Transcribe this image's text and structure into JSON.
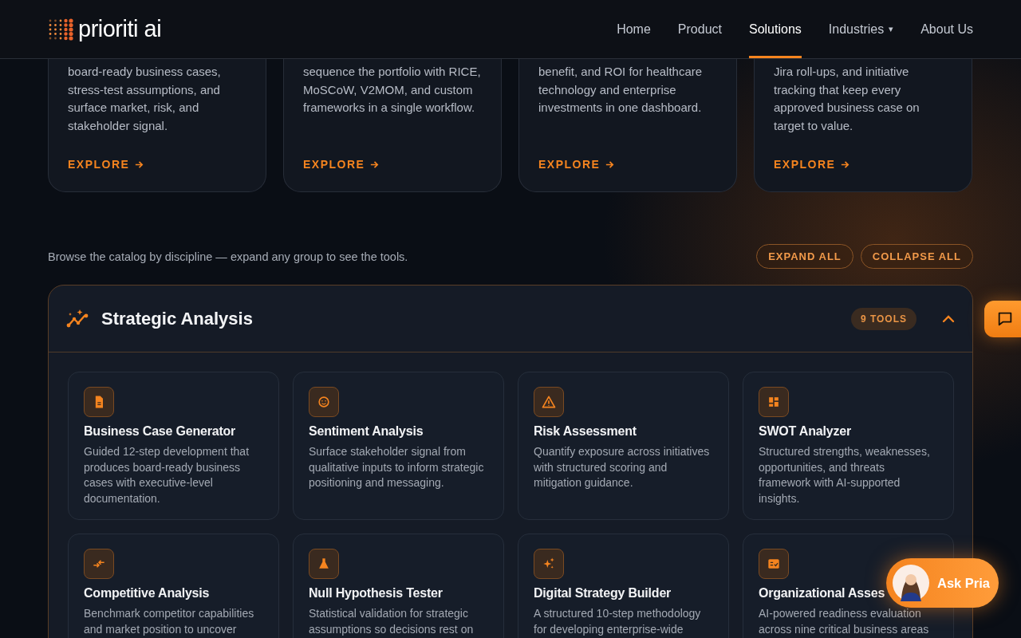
{
  "header": {
    "logo_text": "prioriti ai",
    "nav": [
      {
        "label": "Home",
        "selected": false,
        "dropdown": false
      },
      {
        "label": "Product",
        "selected": false,
        "dropdown": false
      },
      {
        "label": "Solutions",
        "selected": true,
        "dropdown": false
      },
      {
        "label": "Industries",
        "selected": false,
        "dropdown": true,
        "caret": "▾"
      },
      {
        "label": "About Us",
        "selected": false,
        "dropdown": false
      }
    ]
  },
  "feature_cards": [
    {
      "description": "board-ready business cases, stress-test assumptions, and surface market, risk, and stakeholder signal.",
      "link": "EXPLORE"
    },
    {
      "description": "sequence the portfolio with RICE, MoSCoW, V2MOM, and custom frameworks in a single workflow.",
      "link": "EXPLORE"
    },
    {
      "description": "benefit, and ROI for healthcare technology and enterprise investments in one dashboard.",
      "link": "EXPLORE"
    },
    {
      "description": "Jira roll-ups, and initiative tracking that keep every approved business case on target to value.",
      "link": "EXPLORE"
    }
  ],
  "catalog": {
    "intro": "Browse the catalog by discipline — expand any group to see the tools.",
    "buttons": [
      "EXPAND ALL",
      "COLLAPSE ALL"
    ],
    "group": {
      "title": "Strategic Analysis",
      "count": "9 TOOLS",
      "expanded": true,
      "tools": [
        {
          "title": "Business Case Generator",
          "description": "Guided 12-step development that produces board-ready business cases with executive-level documentation."
        },
        {
          "title": "Sentiment Analysis",
          "description": "Surface stakeholder signal from qualitative inputs to inform strategic positioning and messaging."
        },
        {
          "title": "Risk Assessment",
          "description": "Quantify exposure across initiatives with structured scoring and mitigation guidance."
        },
        {
          "title": "SWOT Analyzer",
          "description": "Structured strengths, weaknesses, opportunities, and threats framework with AI-supported insights."
        },
        {
          "title": "Competitive Analysis",
          "description": "Benchmark competitor capabilities and market position to uncover"
        },
        {
          "title": "Null Hypothesis Tester",
          "description": "Statistical validation for strategic assumptions so decisions rest on"
        },
        {
          "title": "Digital Strategy Builder",
          "description": "A structured 10-step methodology for developing enterprise-wide"
        },
        {
          "title": "Organizational Asses",
          "description": "AI-powered readiness evaluation across nine critical business areas"
        }
      ]
    }
  },
  "assistant": {
    "label": "Ask Pria"
  }
}
